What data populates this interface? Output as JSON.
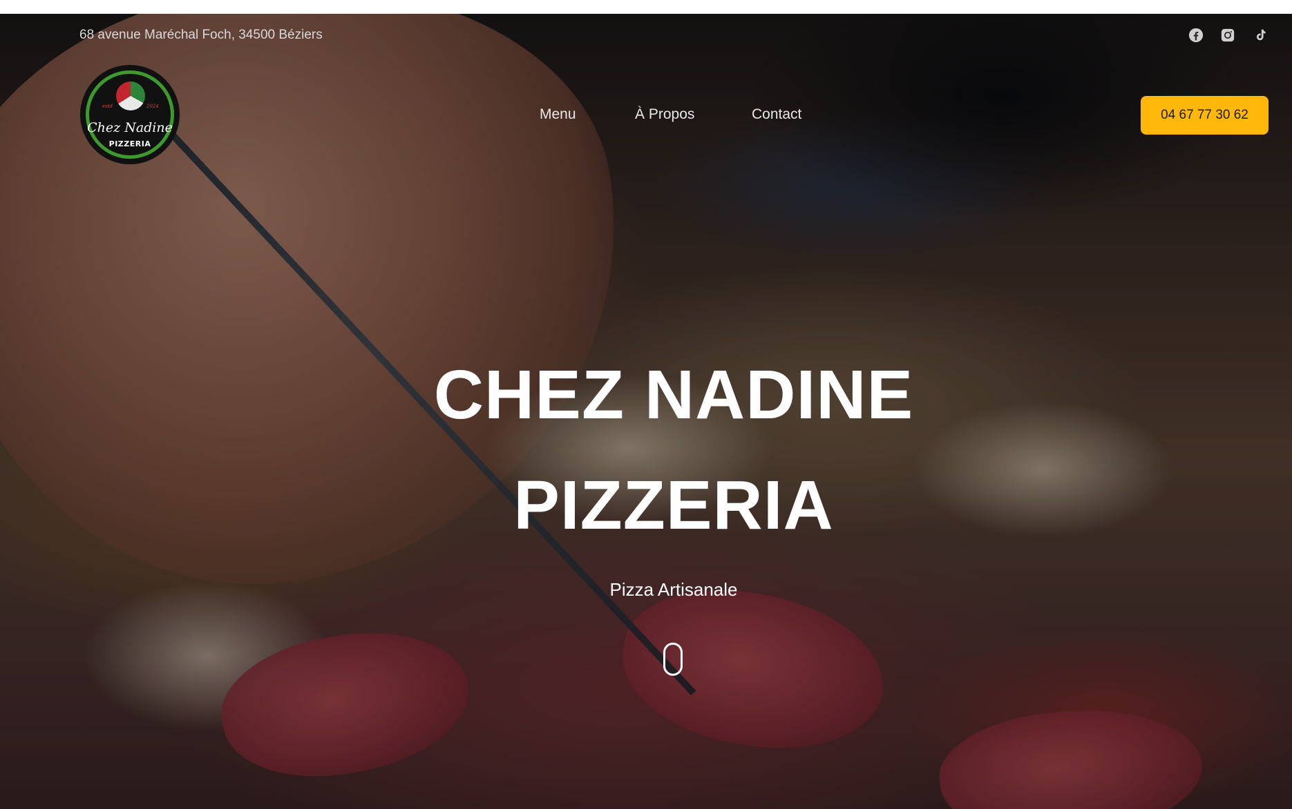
{
  "header": {
    "address": "68 avenue Maréchal Foch, 34500 Béziers",
    "social_icons": [
      "facebook-icon",
      "instagram-icon",
      "tiktok-icon"
    ],
    "logo": {
      "script": "Chez Nadine",
      "subtitle": "PIZZERIA",
      "estd": "estd",
      "year": "2024"
    },
    "nav": [
      "Menu",
      "À Propos",
      "Contact"
    ],
    "phone_label": "04 67 77 30 62"
  },
  "hero": {
    "title_line1": "CHEZ NADINE",
    "title_line2": "PIZZERIA",
    "subtitle": "Pizza Artisanale",
    "scroll_icon": "scroll-mouse-icon"
  },
  "colors": {
    "accent": "#ffb80a",
    "logo_ring": "#3f9a2d",
    "text": "#ffffff"
  }
}
